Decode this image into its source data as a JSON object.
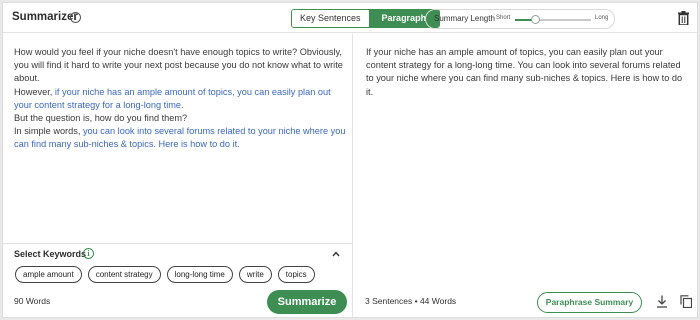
{
  "header": {
    "title": "Summarizer",
    "modes": [
      "Key Sentences",
      "Paragraph"
    ],
    "active_mode": "Paragraph",
    "summary_length": {
      "label": "Summary Length",
      "min_label": "Short",
      "max_label": "Long",
      "level": 0.26
    }
  },
  "input": {
    "segments": [
      {
        "text": "How would you feel if your niche doesn't have enough topics to write? Obviously, you will find it hard to write your next post because you do not know what to write about.",
        "highlight": false,
        "break_after": true
      },
      {
        "text": "However, ",
        "highlight": false,
        "break_after": false
      },
      {
        "text": "if your niche has an ample amount of topics, you can easily plan out your content strategy for a long-long time.",
        "highlight": true,
        "break_after": true
      },
      {
        "text": "But the question is, how do you find them?",
        "highlight": false,
        "break_after": true
      },
      {
        "text": "In simple words, ",
        "highlight": false,
        "break_after": false
      },
      {
        "text": "you can look into several forums related to your niche where you can find many sub-niches & topics. Here is how to do it.",
        "highlight": true,
        "break_after": false
      }
    ],
    "word_count": "90 Words"
  },
  "keywords": {
    "title": "Select Keywords",
    "items": [
      "ample amount",
      "content strategy",
      "long-long time",
      "write",
      "topics"
    ]
  },
  "actions": {
    "summarize_label": "Summarize",
    "paraphrase_label": "Paraphrase Summary"
  },
  "output": {
    "text": "If your niche has an ample amount of topics, you can easily plan out your content strategy for a long-long time. You can look into several forums related to your niche where you can find many sub-niches & topics. Here is how to do it.",
    "stats": "3 Sentences • 44 Words"
  },
  "icons": {
    "title_info": "info-icon",
    "delete": "trash-icon",
    "collapse": "chevron-up-icon",
    "download": "download-icon",
    "copy": "copy-icon"
  },
  "colors": {
    "accent": "#3e8e54",
    "highlight_text": "#3b67c2"
  }
}
